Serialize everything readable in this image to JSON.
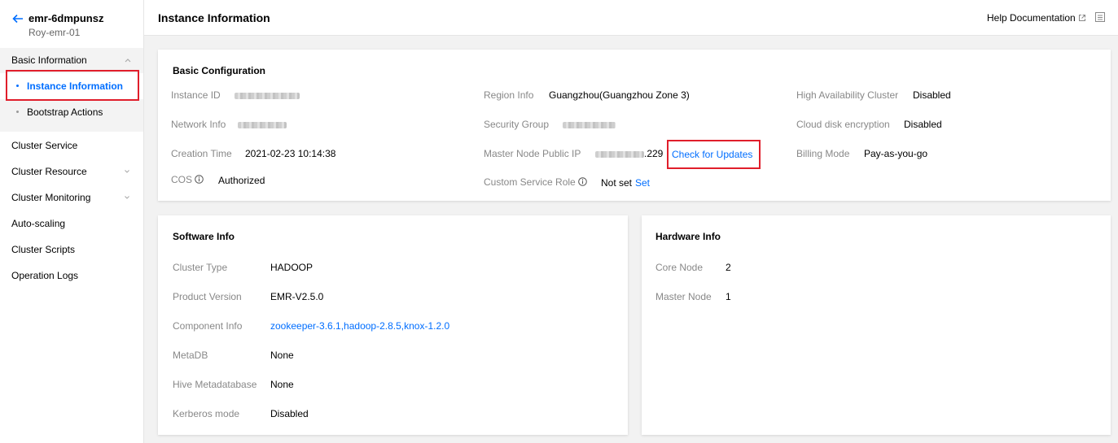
{
  "sidebar": {
    "cluster_id": "emr-6dmpunsz",
    "cluster_name": "Roy-emr-01",
    "group_title": "Basic Information",
    "sub_items": [
      "Instance Information",
      "Bootstrap Actions"
    ],
    "items": [
      "Cluster Service",
      "Cluster Resource",
      "Cluster Monitoring",
      "Auto-scaling",
      "Cluster Scripts",
      "Operation Logs"
    ]
  },
  "header": {
    "title": "Instance Information",
    "help_label": "Help Documentation"
  },
  "basic": {
    "title": "Basic Configuration",
    "instance_id_label": "Instance ID",
    "network_info_label": "Network Info",
    "creation_time_label": "Creation Time",
    "creation_time": "2021-02-23 10:14:38",
    "cos_label": "COS",
    "cos_value": "Authorized",
    "region_label": "Region Info",
    "region_value": "Guangzhou(Guangzhou Zone 3)",
    "security_group_label": "Security Group",
    "master_ip_label": "Master Node Public IP",
    "master_ip_suffix": ".229",
    "check_updates": "Check for Updates",
    "custom_role_label": "Custom Service Role",
    "custom_role_value": "Not set",
    "set_link": "Set",
    "ha_label": "High Availability Cluster",
    "ha_value": "Disabled",
    "cloud_disk_label": "Cloud disk encryption",
    "cloud_disk_value": "Disabled",
    "billing_label": "Billing Mode",
    "billing_value": "Pay-as-you-go"
  },
  "software": {
    "title": "Software Info",
    "cluster_type_label": "Cluster Type",
    "cluster_type": "HADOOP",
    "product_version_label": "Product Version",
    "product_version": "EMR-V2.5.0",
    "component_label": "Component Info",
    "component_value": "zookeeper-3.6.1,hadoop-2.8.5,knox-1.2.0",
    "metadb_label": "MetaDB",
    "metadb_value": "None",
    "hive_label": "Hive Metadatabase",
    "hive_value": "None",
    "kerberos_label": "Kerberos mode",
    "kerberos_value": "Disabled"
  },
  "hardware": {
    "title": "Hardware Info",
    "core_label": "Core Node",
    "core_value": "2",
    "master_label": "Master Node",
    "master_value": "1"
  },
  "colors": {
    "accent": "#006eff",
    "highlight_box": "#e01e2b"
  }
}
